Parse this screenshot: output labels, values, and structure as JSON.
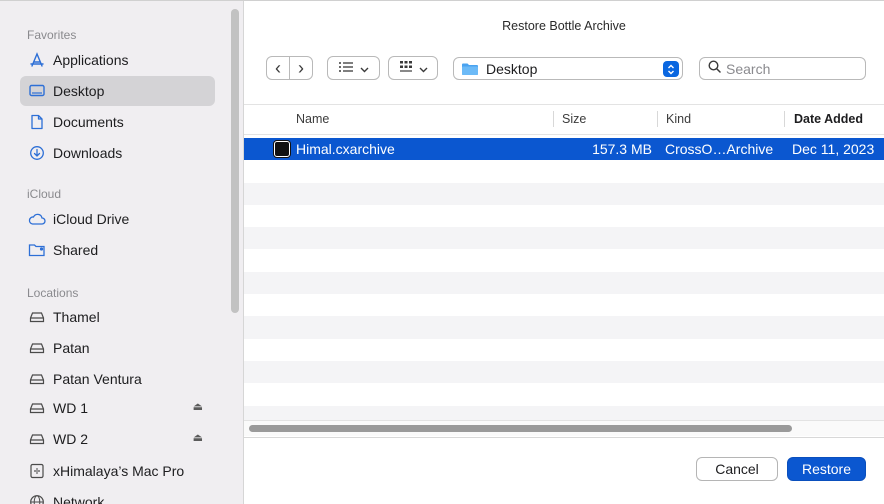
{
  "dialog": {
    "title": "Restore Bottle Archive"
  },
  "sidebar": {
    "favorites_label": "Favorites",
    "favorites": [
      {
        "label": "Applications",
        "icon": "applications-icon"
      },
      {
        "label": "Desktop",
        "icon": "desktop-icon",
        "selected": true
      },
      {
        "label": "Documents",
        "icon": "document-icon"
      },
      {
        "label": "Downloads",
        "icon": "downloads-icon"
      }
    ],
    "icloud_label": "iCloud",
    "icloud": [
      {
        "label": "iCloud Drive",
        "icon": "cloud-icon"
      },
      {
        "label": "Shared",
        "icon": "shared-folder-icon"
      }
    ],
    "locations_label": "Locations",
    "locations": [
      {
        "label": "Thamel",
        "icon": "drive-icon"
      },
      {
        "label": "Patan",
        "icon": "drive-icon"
      },
      {
        "label": "Patan Ventura",
        "icon": "drive-icon"
      },
      {
        "label": "WD 1",
        "icon": "drive-icon",
        "eject": true
      },
      {
        "label": "WD 2",
        "icon": "drive-icon",
        "eject": true
      },
      {
        "label": "xHimalaya’s Mac Pro",
        "icon": "computer-icon"
      },
      {
        "label": "Network",
        "icon": "network-icon"
      }
    ],
    "eject_glyph": "⏏"
  },
  "toolbar": {
    "back_glyph": "‹",
    "forward_glyph": "›",
    "location": "Desktop",
    "search_placeholder": "Search"
  },
  "table": {
    "columns": [
      "Name",
      "Size",
      "Kind",
      "Date Added"
    ],
    "rows": [
      {
        "name": "Himal.cxarchive",
        "size": "157.3 MB",
        "kind": "CrossO…Archive",
        "date": "Dec 11, 2023",
        "selected": true
      }
    ]
  },
  "buttons": {
    "cancel": "Cancel",
    "restore": "Restore"
  },
  "colors": {
    "accent": "#0b57d0",
    "sidebar_bg": "#f0eef1",
    "sidebar_selected": "#d4d3d6"
  }
}
